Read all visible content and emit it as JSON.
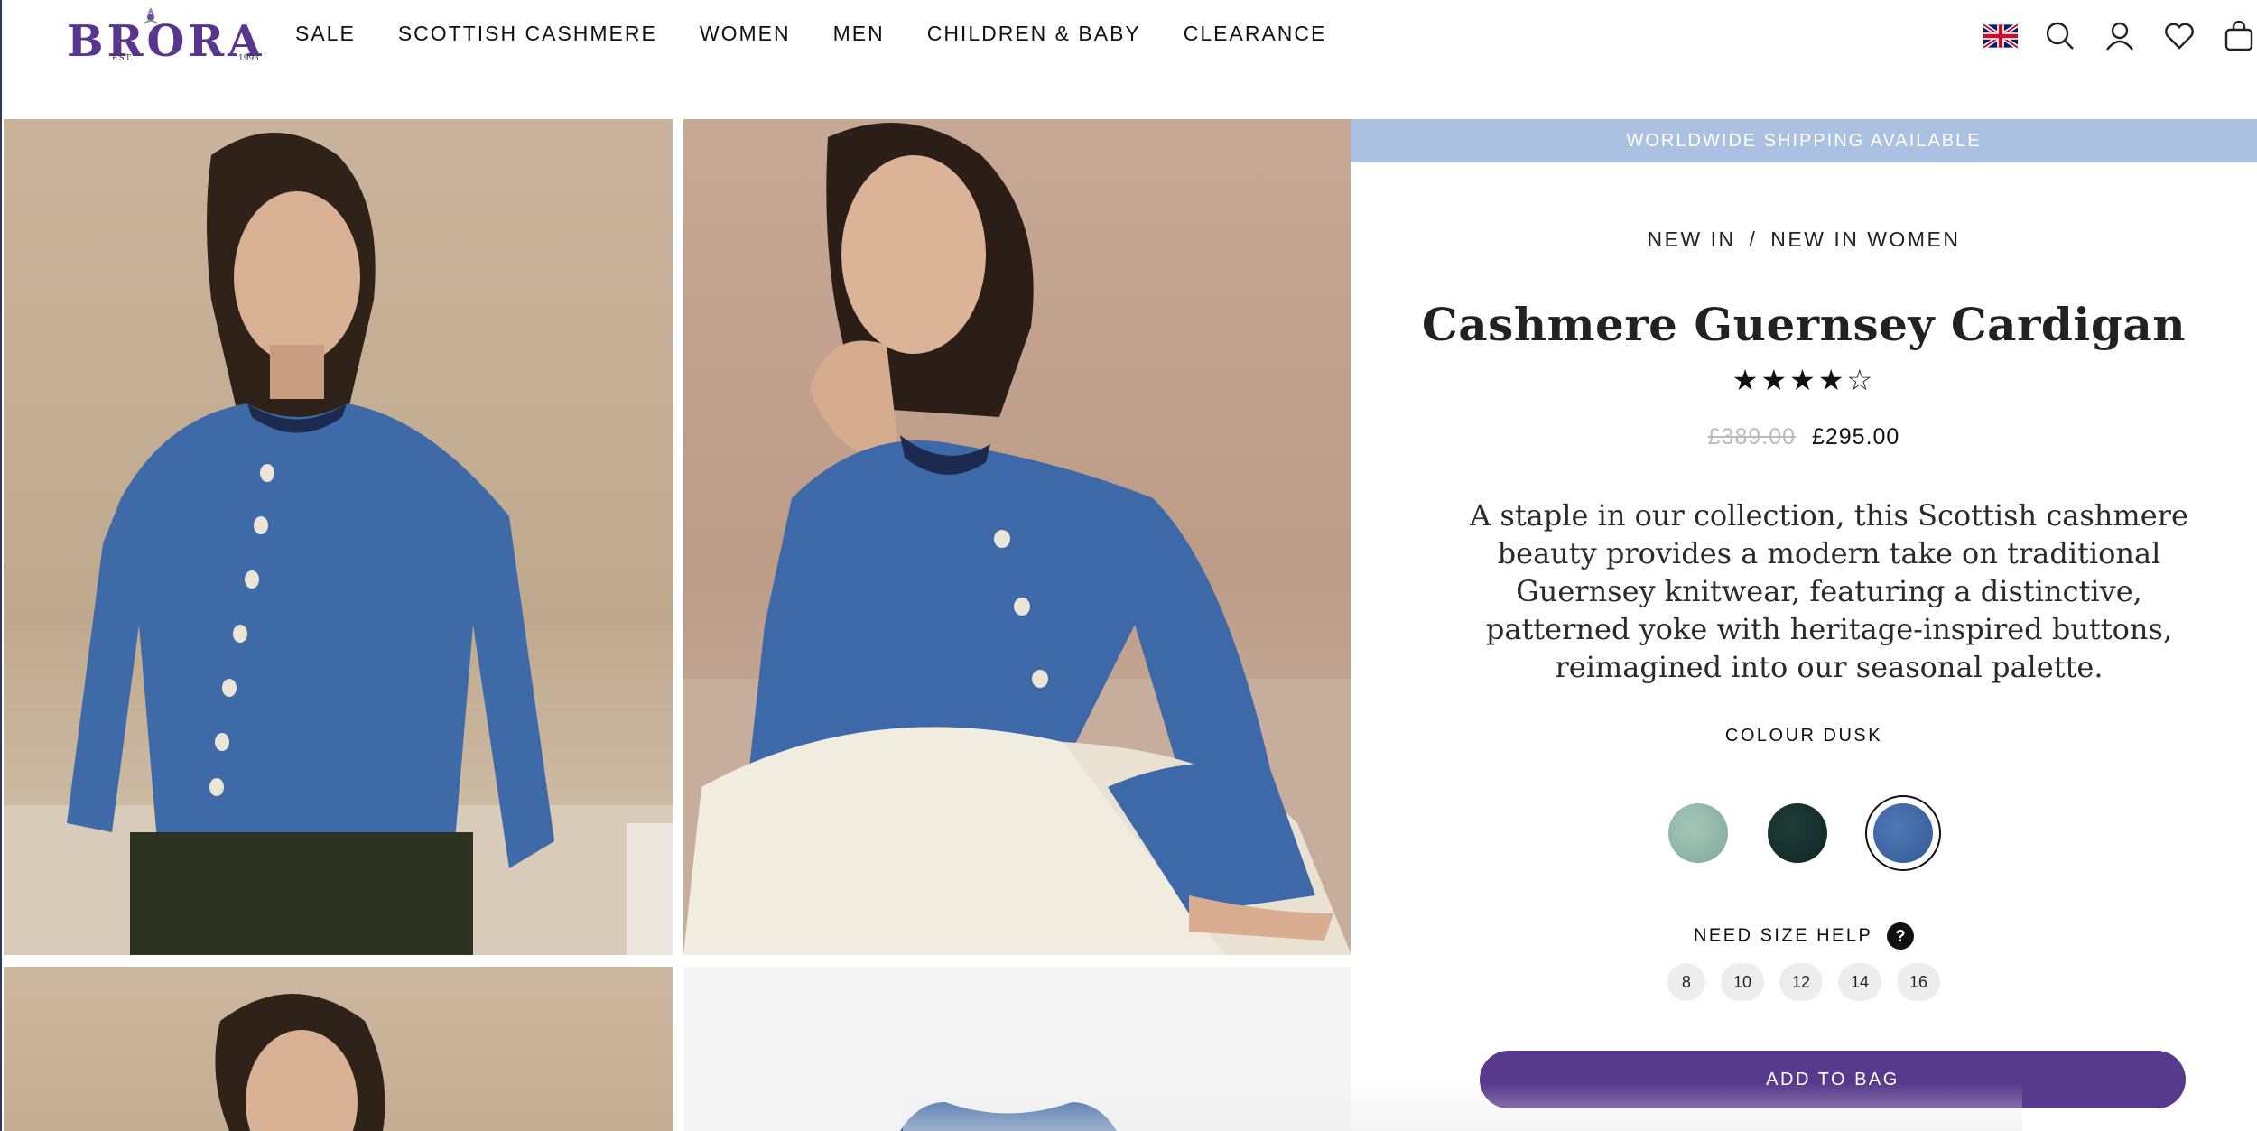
{
  "header": {
    "logo": {
      "text": "BRORA",
      "est": "EST.",
      "year": "1993"
    },
    "nav": [
      "SALE",
      "SCOTTISH CASHMERE",
      "WOMEN",
      "MEN",
      "CHILDREN & BABY",
      "CLEARANCE"
    ],
    "icons": [
      "uk-flag-icon",
      "search-icon",
      "account-icon",
      "wishlist-heart-icon",
      "bag-icon"
    ]
  },
  "gallery": {
    "photos": [
      "model-front-photo",
      "model-seated-photo",
      "model-closeup-photo",
      "product-flat-photo"
    ]
  },
  "product": {
    "banner": "WORLDWIDE SHIPPING AVAILABLE",
    "breadcrumb": [
      "NEW IN",
      "NEW IN WOMEN"
    ],
    "breadcrumb_sep": "/",
    "title": "Cashmere Guernsey Cardigan",
    "rating": {
      "stars": "★★★★☆",
      "value": 4,
      "max": 5
    },
    "price_old": "£389.00",
    "price_new": "£295.00",
    "description": "A staple in our collection, this Scottish cashmere beauty provides a modern take on traditional Guernsey knitwear, featuring a distinctive, patterned yoke with heritage-inspired buttons, reimagined into our seasonal palette.",
    "colour_label": "COLOUR DUSK",
    "swatches": [
      {
        "name": "sage",
        "color": "#8fb5a6"
      },
      {
        "name": "dark-green",
        "color": "#15302c"
      },
      {
        "name": "dusk",
        "color": "#3e66a3",
        "selected": true
      }
    ],
    "size_help": "NEED SIZE HELP",
    "size_help_icon": "?",
    "sizes": [
      "8",
      "10",
      "12",
      "14",
      "16"
    ],
    "add_to_bag": "ADD TO BAG"
  },
  "colors": {
    "brand": "#5a3590",
    "button": "#583a8c",
    "banner": "#aac1e2"
  }
}
